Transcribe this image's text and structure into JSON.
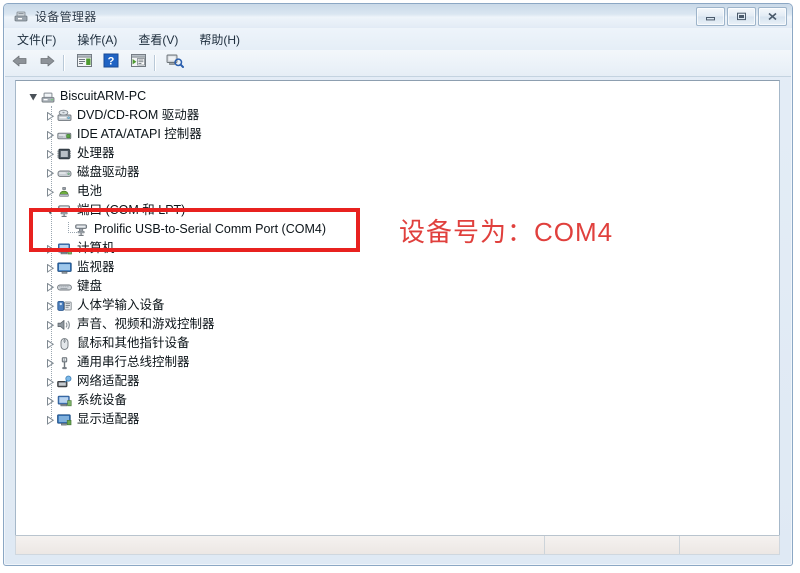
{
  "window": {
    "title": "设备管理器",
    "title_icon": "device-manager-icon",
    "caption": {
      "minimize_label": "—",
      "maximize_label": "❐",
      "close_label": "✕"
    }
  },
  "menubar": {
    "items": [
      {
        "label": "文件(F)",
        "name": "menu-file"
      },
      {
        "label": "操作(A)",
        "name": "menu-action"
      },
      {
        "label": "查看(V)",
        "name": "menu-view"
      },
      {
        "label": "帮助(H)",
        "name": "menu-help"
      }
    ]
  },
  "toolbar": {
    "buttons": [
      {
        "icon": "back-arrow-icon",
        "name": "toolbar-back"
      },
      {
        "icon": "forward-arrow-icon",
        "name": "toolbar-forward"
      },
      {
        "icon": "separator",
        "name": "toolbar-separator-1"
      },
      {
        "icon": "properties-icon",
        "name": "toolbar-properties"
      },
      {
        "icon": "help-icon",
        "name": "toolbar-help",
        "glyph": "?"
      },
      {
        "icon": "show-hidden-devices-icon",
        "name": "toolbar-show-hidden"
      },
      {
        "icon": "separator",
        "name": "toolbar-separator-2"
      },
      {
        "icon": "scan-hardware-changes-icon",
        "name": "toolbar-scan-hardware"
      }
    ]
  },
  "tree": {
    "root": {
      "label": "BiscuitARM-PC",
      "icon": "computer-icon",
      "expanded": true
    },
    "nodes": [
      {
        "label": "DVD/CD-ROM 驱动器",
        "icon": "dvd-drive-icon",
        "expanded": false,
        "level": 1
      },
      {
        "label": "IDE ATA/ATAPI 控制器",
        "icon": "ide-controller-icon",
        "expanded": false,
        "level": 1
      },
      {
        "label": "处理器",
        "icon": "processor-icon",
        "expanded": false,
        "level": 1
      },
      {
        "label": "磁盘驱动器",
        "icon": "disk-drive-icon",
        "expanded": false,
        "level": 1
      },
      {
        "label": "电池",
        "icon": "battery-icon",
        "expanded": false,
        "level": 1
      },
      {
        "label": "端口 (COM 和 LPT)",
        "icon": "ports-icon",
        "expanded": true,
        "level": 1,
        "highlighted": true
      },
      {
        "label": "Prolific USB-to-Serial Comm Port (COM4)",
        "icon": "ports-icon",
        "expanded": null,
        "level": 2,
        "highlighted": true
      },
      {
        "label": "计算机",
        "icon": "computer-node-icon",
        "expanded": false,
        "level": 1
      },
      {
        "label": "监视器",
        "icon": "monitor-icon",
        "expanded": false,
        "level": 1
      },
      {
        "label": "键盘",
        "icon": "keyboard-icon",
        "expanded": false,
        "level": 1
      },
      {
        "label": "人体学输入设备",
        "icon": "hid-icon",
        "expanded": false,
        "level": 1
      },
      {
        "label": "声音、视频和游戏控制器",
        "icon": "sound-icon",
        "expanded": false,
        "level": 1
      },
      {
        "label": "鼠标和其他指针设备",
        "icon": "mouse-icon",
        "expanded": false,
        "level": 1
      },
      {
        "label": "通用串行总线控制器",
        "icon": "usb-icon",
        "expanded": false,
        "level": 1
      },
      {
        "label": "网络适配器",
        "icon": "network-adapter-icon",
        "expanded": false,
        "level": 1
      },
      {
        "label": "系统设备",
        "icon": "system-device-icon",
        "expanded": false,
        "level": 1
      },
      {
        "label": "显示适配器",
        "icon": "display-adapter-icon",
        "expanded": false,
        "level": 1
      }
    ]
  },
  "annotation": {
    "text": "设备号为：COM4",
    "color": "#e0403d",
    "box_color": "#e8211f"
  },
  "statusbar": {
    "main_text": "",
    "pane2_text": "",
    "pane3_text": ""
  }
}
